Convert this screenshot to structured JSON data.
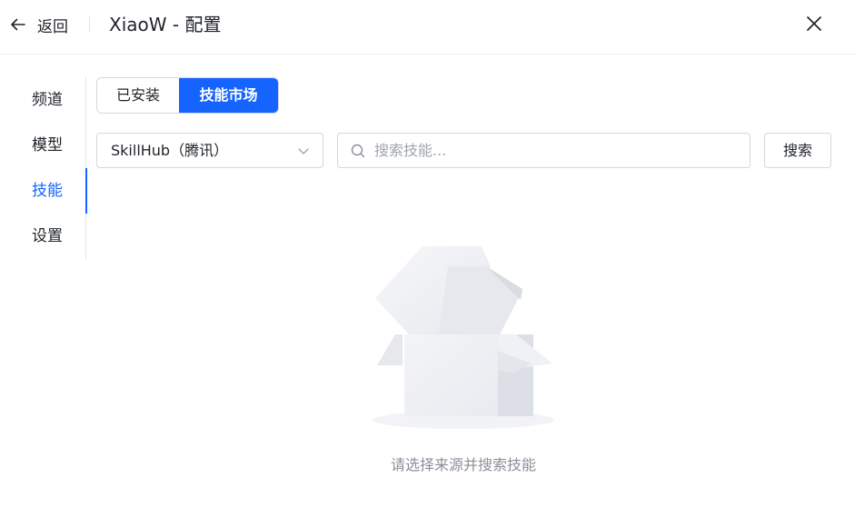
{
  "header": {
    "back_label": "返回",
    "title": "XiaoW - 配置",
    "back_icon": "arrow-left-icon",
    "close_icon": "close-icon"
  },
  "sidebar": {
    "items": [
      {
        "label": "频道",
        "active": false
      },
      {
        "label": "模型",
        "active": false
      },
      {
        "label": "技能",
        "active": true
      },
      {
        "label": "设置",
        "active": false
      }
    ]
  },
  "tabs": {
    "installed": "已安装",
    "market": "技能市场",
    "active": "market"
  },
  "filter": {
    "source_value": "SkillHub（腾讯）",
    "search_placeholder": "搜索技能...",
    "search_value": "",
    "search_button": "搜索"
  },
  "empty_state": {
    "message": "请选择来源并搜索技能",
    "illustration": "empty-box-icon"
  },
  "colors": {
    "accent": "#1664ff",
    "text": "#1f2329",
    "muted": "#8a8f99",
    "border": "#d3d7de"
  }
}
